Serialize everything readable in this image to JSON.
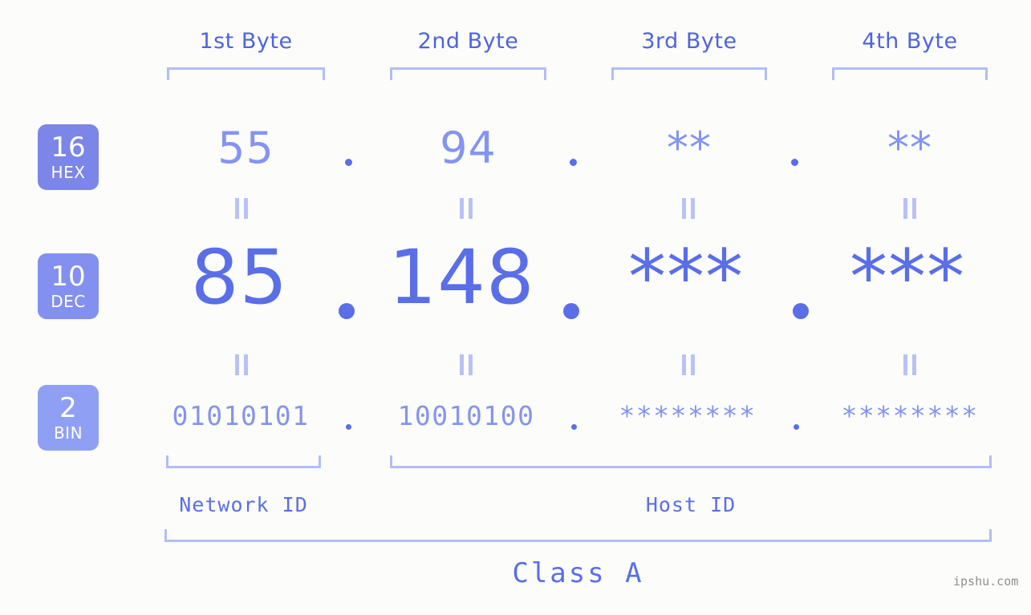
{
  "background_color": "#fcfdfa",
  "accent_colors": {
    "strong_blue": "#5a6ee8",
    "mid_periwinkle": "#8494f0",
    "light_periwinkle": "#b2bdf6",
    "badge_hex": "#7b86e8",
    "badge_dec": "#8390ef",
    "badge_bin": "#8fa0f4"
  },
  "byte_headers": [
    {
      "label": "1st Byte"
    },
    {
      "label": "2nd Byte"
    },
    {
      "label": "3rd Byte"
    },
    {
      "label": "4th Byte"
    }
  ],
  "bases": [
    {
      "number": "16",
      "name": "HEX"
    },
    {
      "number": "10",
      "name": "DEC"
    },
    {
      "number": "2",
      "name": "BIN"
    }
  ],
  "rows": {
    "hex": {
      "values": [
        "55",
        "94",
        "**",
        "**"
      ]
    },
    "dec": {
      "values": [
        "85",
        "148",
        "***",
        "***"
      ]
    },
    "bin": {
      "values": [
        "01010101",
        "10010100",
        "********",
        "********"
      ]
    }
  },
  "separator": ".",
  "equals_mark": "=",
  "segments": {
    "network_id": "Network ID",
    "host_id": "Host ID"
  },
  "class_label": "Class A",
  "watermark": "ipshu.com"
}
